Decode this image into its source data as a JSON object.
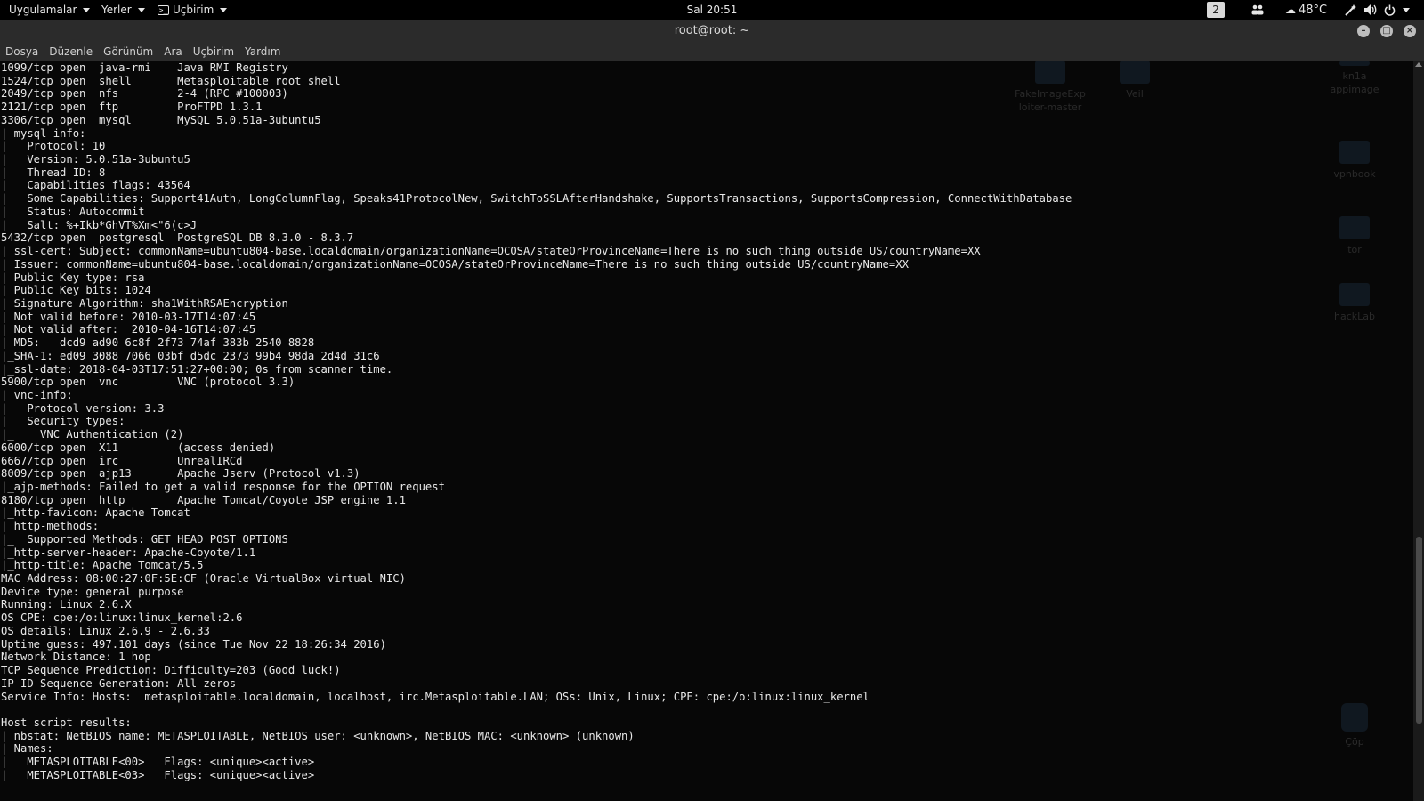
{
  "topbar": {
    "applications": "Uygulamalar",
    "places": "Yerler",
    "terminal_app": "Uçbirim",
    "clock": "Sal 20:51",
    "workspace": "2",
    "temperature": "48°C"
  },
  "window": {
    "title": "root@root: ~"
  },
  "menubar": {
    "items": [
      "Dosya",
      "Düzenle",
      "Görünüm",
      "Ara",
      "Uçbirim",
      "Yardım"
    ]
  },
  "desktop_icons": [
    {
      "label": "FakeImageExploiter-master"
    },
    {
      "label": "Veil"
    },
    {
      "label": "kn1a appimage"
    },
    {
      "label": "vpnbook"
    },
    {
      "label": "tor"
    },
    {
      "label": "hackLab"
    },
    {
      "label": "Çöp"
    }
  ],
  "terminal": {
    "lines": [
      "1099/tcp open  java-rmi    Java RMI Registry",
      "1524/tcp open  shell       Metasploitable root shell",
      "2049/tcp open  nfs         2-4 (RPC #100003)",
      "2121/tcp open  ftp         ProFTPD 1.3.1",
      "3306/tcp open  mysql       MySQL 5.0.51a-3ubuntu5",
      "| mysql-info:",
      "|   Protocol: 10",
      "|   Version: 5.0.51a-3ubuntu5",
      "|   Thread ID: 8",
      "|   Capabilities flags: 43564",
      "|   Some Capabilities: Support41Auth, LongColumnFlag, Speaks41ProtocolNew, SwitchToSSLAfterHandshake, SupportsTransactions, SupportsCompression, ConnectWithDatabase",
      "|   Status: Autocommit",
      "|_  Salt: %+Ikb*GhVT%Xm<\"6(c>J",
      "5432/tcp open  postgresql  PostgreSQL DB 8.3.0 - 8.3.7",
      "| ssl-cert: Subject: commonName=ubuntu804-base.localdomain/organizationName=OCOSA/stateOrProvinceName=There is no such thing outside US/countryName=XX",
      "| Issuer: commonName=ubuntu804-base.localdomain/organizationName=OCOSA/stateOrProvinceName=There is no such thing outside US/countryName=XX",
      "| Public Key type: rsa",
      "| Public Key bits: 1024",
      "| Signature Algorithm: sha1WithRSAEncryption",
      "| Not valid before: 2010-03-17T14:07:45",
      "| Not valid after:  2010-04-16T14:07:45",
      "| MD5:   dcd9 ad90 6c8f 2f73 74af 383b 2540 8828",
      "|_SHA-1: ed09 3088 7066 03bf d5dc 2373 99b4 98da 2d4d 31c6",
      "|_ssl-date: 2018-04-03T17:51:27+00:00; 0s from scanner time.",
      "5900/tcp open  vnc         VNC (protocol 3.3)",
      "| vnc-info:",
      "|   Protocol version: 3.3",
      "|   Security types:",
      "|_    VNC Authentication (2)",
      "6000/tcp open  X11         (access denied)",
      "6667/tcp open  irc         UnrealIRCd",
      "8009/tcp open  ajp13       Apache Jserv (Protocol v1.3)",
      "|_ajp-methods: Failed to get a valid response for the OPTION request",
      "8180/tcp open  http        Apache Tomcat/Coyote JSP engine 1.1",
      "|_http-favicon: Apache Tomcat",
      "| http-methods:",
      "|_  Supported Methods: GET HEAD POST OPTIONS",
      "|_http-server-header: Apache-Coyote/1.1",
      "|_http-title: Apache Tomcat/5.5",
      "MAC Address: 08:00:27:0F:5E:CF (Oracle VirtualBox virtual NIC)",
      "Device type: general purpose",
      "Running: Linux 2.6.X",
      "OS CPE: cpe:/o:linux:linux_kernel:2.6",
      "OS details: Linux 2.6.9 - 2.6.33",
      "Uptime guess: 497.101 days (since Tue Nov 22 18:26:34 2016)",
      "Network Distance: 1 hop",
      "TCP Sequence Prediction: Difficulty=203 (Good luck!)",
      "IP ID Sequence Generation: All zeros",
      "Service Info: Hosts:  metasploitable.localdomain, localhost, irc.Metasploitable.LAN; OSs: Unix, Linux; CPE: cpe:/o:linux:linux_kernel",
      "",
      "Host script results:",
      "| nbstat: NetBIOS name: METASPLOITABLE, NetBIOS user: <unknown>, NetBIOS MAC: <unknown> (unknown)",
      "| Names:",
      "|   METASPLOITABLE<00>   Flags: <unique><active>",
      "|   METASPLOITABLE<03>   Flags: <unique><active>"
    ]
  }
}
